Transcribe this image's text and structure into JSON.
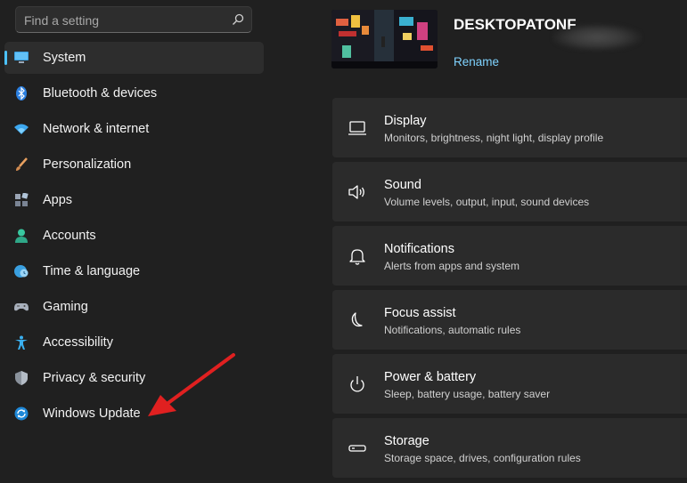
{
  "search": {
    "placeholder": "Find a setting"
  },
  "sidebar": {
    "items": [
      {
        "label": "System",
        "icon": "monitor-icon",
        "selected": true
      },
      {
        "label": "Bluetooth & devices",
        "icon": "bluetooth-icon"
      },
      {
        "label": "Network & internet",
        "icon": "wifi-icon"
      },
      {
        "label": "Personalization",
        "icon": "brush-icon"
      },
      {
        "label": "Apps",
        "icon": "apps-icon"
      },
      {
        "label": "Accounts",
        "icon": "person-icon"
      },
      {
        "label": "Time & language",
        "icon": "globe-clock-icon"
      },
      {
        "label": "Gaming",
        "icon": "gamepad-icon"
      },
      {
        "label": "Accessibility",
        "icon": "accessibility-icon"
      },
      {
        "label": "Privacy & security",
        "icon": "shield-icon"
      },
      {
        "label": "Windows Update",
        "icon": "update-icon"
      }
    ]
  },
  "header": {
    "device_name": "DESKTOPATONF",
    "rename_label": "Rename"
  },
  "cards": [
    {
      "title": "Display",
      "subtitle": "Monitors, brightness, night light, display profile",
      "icon": "laptop-icon"
    },
    {
      "title": "Sound",
      "subtitle": "Volume levels, output, input, sound devices",
      "icon": "speaker-icon"
    },
    {
      "title": "Notifications",
      "subtitle": "Alerts from apps and system",
      "icon": "bell-icon"
    },
    {
      "title": "Focus assist",
      "subtitle": "Notifications, automatic rules",
      "icon": "moon-icon"
    },
    {
      "title": "Power & battery",
      "subtitle": "Sleep, battery usage, battery saver",
      "icon": "power-icon"
    },
    {
      "title": "Storage",
      "subtitle": "Storage space, drives, configuration rules",
      "icon": "drive-icon"
    }
  ],
  "colors": {
    "accent": "#4cc2ff",
    "background": "#202020",
    "card": "#2b2b2b",
    "annotation": "#e02020"
  }
}
